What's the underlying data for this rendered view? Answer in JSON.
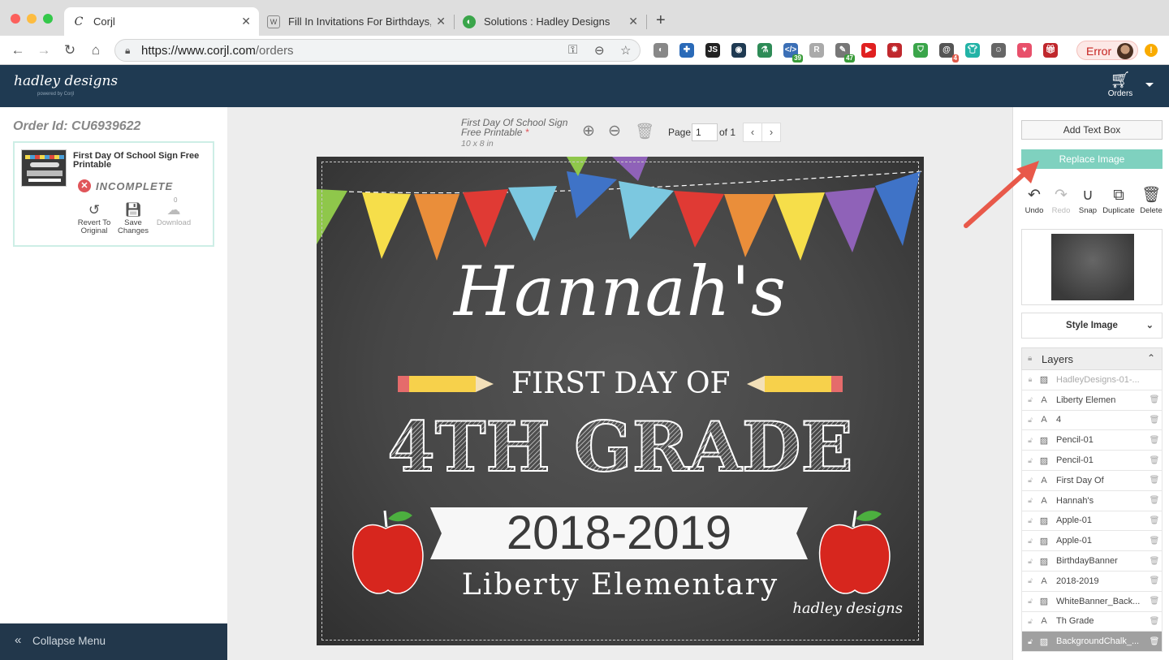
{
  "browser": {
    "tabs": [
      {
        "title": "Corjl",
        "active": true,
        "icon": "corjl-icon"
      },
      {
        "title": "Fill In Invitations For Birthdays,",
        "active": false,
        "icon": "doc-icon"
      },
      {
        "title": "Solutions : Hadley Designs",
        "active": false,
        "icon": "hadley-icon"
      }
    ],
    "url_prefix": "https://www.corjl.com",
    "url_path": "/orders",
    "extensions": [
      {
        "name": "ext-shield-icon",
        "color": "#888888",
        "badge": ""
      },
      {
        "name": "ext-cross-icon",
        "color": "#2a6ab8",
        "badge": ""
      },
      {
        "name": "ext-js-icon",
        "color": "#222222",
        "badge": ""
      },
      {
        "name": "ext-eye-icon",
        "color": "#1f3a52",
        "badge": ""
      },
      {
        "name": "ext-flask-icon",
        "color": "#2e8b57",
        "badge": ""
      },
      {
        "name": "ext-code-icon",
        "color": "#3b6fb6",
        "badge": "39"
      },
      {
        "name": "ext-r-icon",
        "color": "#aaaaaa",
        "badge": ""
      },
      {
        "name": "ext-pen-icon",
        "color": "#777777",
        "badge": "47"
      },
      {
        "name": "ext-youtube-icon",
        "color": "#e02020",
        "badge": ""
      },
      {
        "name": "ext-bug-icon",
        "color": "#c0282d",
        "badge": ""
      },
      {
        "name": "ext-bag-icon",
        "color": "#3aa54a",
        "badge": ""
      },
      {
        "name": "ext-at-icon",
        "color": "#555555",
        "badge": "4"
      },
      {
        "name": "ext-shirt-icon",
        "color": "#22b3a6",
        "badge": ""
      },
      {
        "name": "ext-robot-icon",
        "color": "#666666",
        "badge": ""
      },
      {
        "name": "ext-heart-icon",
        "color": "#e8506b",
        "badge": ""
      },
      {
        "name": "ext-gift-icon",
        "color": "#c0282d",
        "badge": ""
      }
    ],
    "error_label": "Error"
  },
  "header": {
    "brand": "hadley designs",
    "brand_sub": "powered by Corjl",
    "orders_label": "Orders"
  },
  "sidebar": {
    "order_id": "Order Id: CU6939622",
    "product_title": "First Day Of School Sign Free Printable",
    "status": "INCOMPLETE",
    "actions": {
      "revert": "Revert To Original",
      "save": "Save Changes",
      "download": "Download"
    },
    "download_count": "0",
    "collapse_label": "Collapse Menu"
  },
  "canvas": {
    "doc_title": "First Day Of School Sign Free Printable",
    "required_mark": "*",
    "doc_size": "10 x 8 in",
    "page_label": "Page",
    "page_value": "1",
    "page_of": "of 1",
    "design": {
      "name": "Hannah's",
      "first_day": "FIRST DAY OF",
      "grade": "4TH GRADE",
      "year": "2018-2019",
      "school": "Liberty Elementary",
      "signature": "hadley designs"
    }
  },
  "right_panel": {
    "add_text_label": "Add Text Box",
    "replace_image_label": "Replace Image",
    "actions": {
      "undo": "Undo",
      "redo": "Redo",
      "snap": "Snap",
      "duplicate": "Duplicate",
      "delete": "Delete"
    },
    "style_image_label": "Style Image",
    "layers_title": "Layers",
    "layers": [
      {
        "name": "HadleyDesigns-01-...",
        "type": "image",
        "locked": true,
        "selected": false
      },
      {
        "name": "Liberty Elemen",
        "type": "text",
        "locked": false,
        "selected": false
      },
      {
        "name": "4",
        "type": "text",
        "locked": false,
        "selected": false
      },
      {
        "name": "Pencil-01",
        "type": "image",
        "locked": false,
        "selected": false
      },
      {
        "name": "Pencil-01",
        "type": "image",
        "locked": false,
        "selected": false
      },
      {
        "name": "First Day Of",
        "type": "text",
        "locked": false,
        "selected": false
      },
      {
        "name": "Hannah's",
        "type": "text",
        "locked": false,
        "selected": false
      },
      {
        "name": "Apple-01",
        "type": "image",
        "locked": false,
        "selected": false
      },
      {
        "name": "Apple-01",
        "type": "image",
        "locked": false,
        "selected": false
      },
      {
        "name": "BirthdayBanner",
        "type": "image",
        "locked": false,
        "selected": false
      },
      {
        "name": "2018-2019",
        "type": "text",
        "locked": false,
        "selected": false
      },
      {
        "name": "WhiteBanner_Back...",
        "type": "image",
        "locked": false,
        "selected": false
      },
      {
        "name": "Th Grade",
        "type": "text",
        "locked": false,
        "selected": false
      },
      {
        "name": "BackgroundChalk_...",
        "type": "image",
        "locked": false,
        "selected": true
      }
    ]
  },
  "colors": {
    "header_bg": "#1f3a52",
    "accent_teal": "#7fd1bf",
    "status_red": "#e0555a",
    "annotation_arrow": "#e8594a"
  }
}
